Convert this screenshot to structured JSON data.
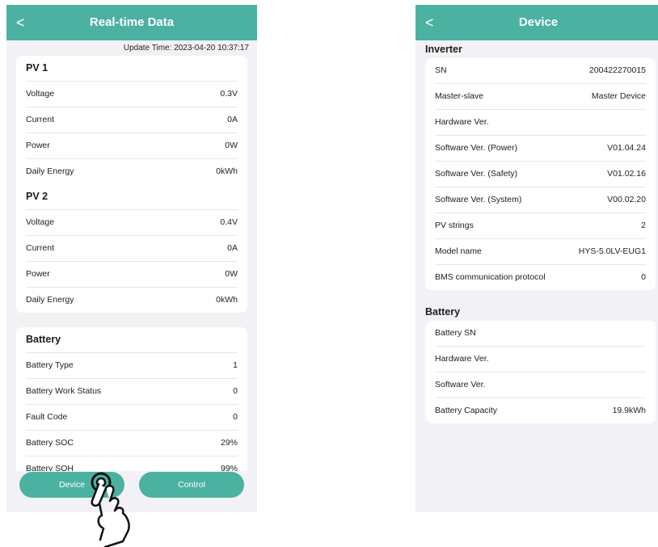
{
  "left": {
    "title": "Real-time Data",
    "back_icon": "<",
    "update_time": "Update Time: 2023-04-20 10:37:17",
    "pv1": {
      "title": "PV 1",
      "rows": [
        {
          "label": "Voltage",
          "value": "0.3V"
        },
        {
          "label": "Current",
          "value": "0A"
        },
        {
          "label": "Power",
          "value": "0W"
        },
        {
          "label": "Daily Energy",
          "value": "0kWh"
        }
      ]
    },
    "pv2": {
      "title": "PV 2",
      "rows": [
        {
          "label": "Voltage",
          "value": "0.4V"
        },
        {
          "label": "Current",
          "value": "0A"
        },
        {
          "label": "Power",
          "value": "0W"
        },
        {
          "label": "Daily Energy",
          "value": "0kWh"
        }
      ]
    },
    "battery": {
      "title": "Battery",
      "rows": [
        {
          "label": "Battery Type",
          "value": "1"
        },
        {
          "label": "Battery Work Status",
          "value": "0"
        },
        {
          "label": "Fault Code",
          "value": "0"
        },
        {
          "label": "Battery SOC",
          "value": "29%"
        },
        {
          "label": "Battery SOH",
          "value": "99%"
        }
      ]
    },
    "buttons": {
      "device": "Device",
      "control": "Control"
    }
  },
  "right": {
    "title": "Device",
    "back_icon": "<",
    "inverter": {
      "title": "Inverter",
      "rows": [
        {
          "label": "SN",
          "value": "200422270015"
        },
        {
          "label": "Master-slave",
          "value": "Master Device"
        },
        {
          "label": "Hardware Ver.",
          "value": ""
        },
        {
          "label": "Software Ver. (Power)",
          "value": "V01.04.24"
        },
        {
          "label": "Software Ver. (Safety)",
          "value": "V01.02.16"
        },
        {
          "label": "Software Ver. (System)",
          "value": "V00.02.20"
        },
        {
          "label": "PV strings",
          "value": "2"
        },
        {
          "label": "Model name",
          "value": "HYS-5.0LV-EUG1"
        },
        {
          "label": "BMS communication protocol",
          "value": "0"
        }
      ]
    },
    "battery": {
      "title": "Battery",
      "rows": [
        {
          "label": "Battery SN",
          "value": ""
        },
        {
          "label": "Hardware Ver.",
          "value": ""
        },
        {
          "label": "Software Ver.",
          "value": ""
        },
        {
          "label": "Battery Capacity",
          "value": "19.9kWh"
        }
      ]
    }
  },
  "colors": {
    "accent": "#4bb1a1",
    "background": "#f2f2f6"
  },
  "icons": {
    "back": "chevron-left-icon",
    "tap": "hand-tap-icon"
  }
}
